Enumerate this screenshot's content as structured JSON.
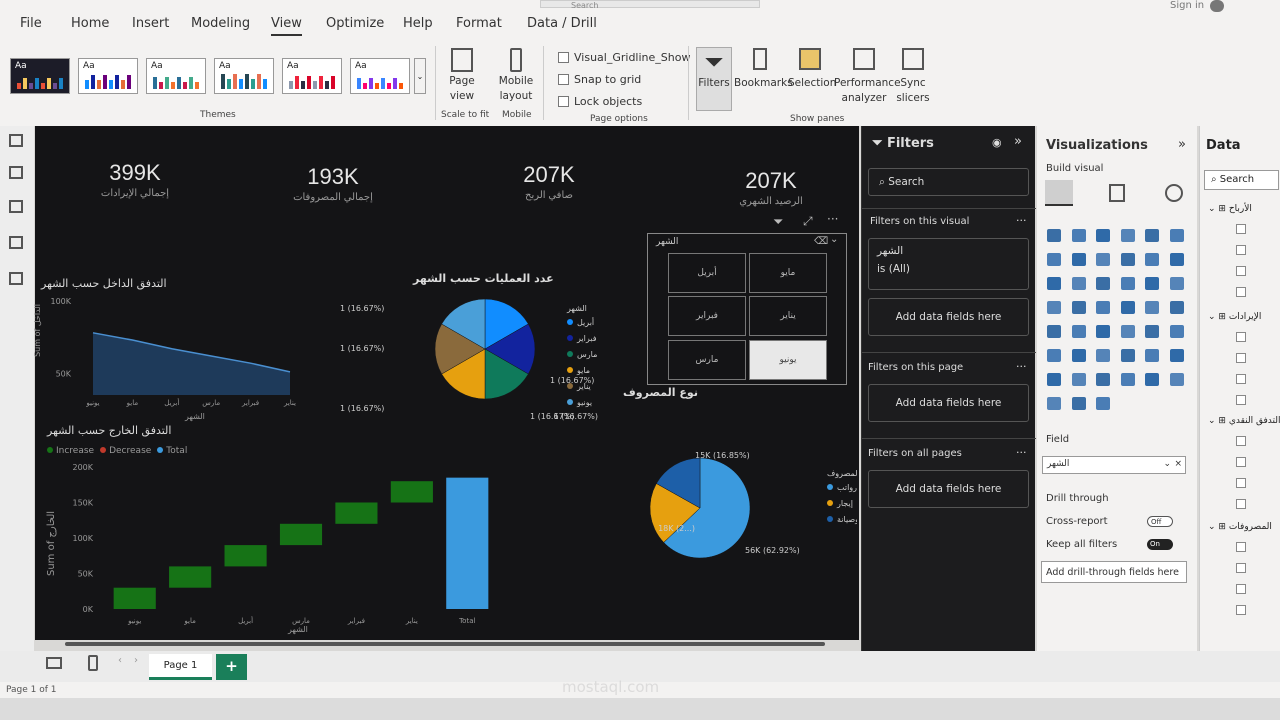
{
  "menu": {
    "items": [
      "File",
      "Home",
      "Insert",
      "Modeling",
      "View",
      "Optimize",
      "Help",
      "Format",
      "Data / Drill"
    ],
    "active": "View",
    "signin": "Sign in",
    "search": "Search"
  },
  "ribbon": {
    "themes_label": "Themes",
    "page_view": "Page view",
    "scale_to_fit": "Scale to fit",
    "mobile_layout": "Mobile layout",
    "mobile": "Mobile",
    "gridlines": "Visual_Gridline_Show",
    "snap": "Snap to grid",
    "lock": "Lock objects",
    "page_options": "Page options",
    "filters": "Filters",
    "bookmarks": "Bookmarks",
    "selection": "Selection",
    "performance": "Performance analyzer",
    "sync": "Sync slicers",
    "show_panes": "Show panes",
    "aa": "Aa"
  },
  "kpis": [
    {
      "value": "399K",
      "label": "إجمالي الإيرادات"
    },
    {
      "value": "193K",
      "label": "إجمالي المصروفات"
    },
    {
      "value": "207K",
      "label": "صافي الربح"
    },
    {
      "value": "207K",
      "label": "الرصيد الشهري"
    }
  ],
  "area_chart": {
    "title": "التدفق الداخل حسب الشهر",
    "ylabel": "Sum of الداخل",
    "xlabel": "الشهر"
  },
  "pie1": {
    "title": "عدد العمليات حسب الشهر",
    "legend_title": "الشهر"
  },
  "pie2": {
    "title": "نوع المصروف",
    "legend_title": "نوع المصروف"
  },
  "waterfall": {
    "title": "التدفق الخارج حسب الشهر",
    "ylabel": "Sum of الخارج",
    "xlabel": "الشهر",
    "legend": [
      "Increase",
      "Decrease",
      "Total"
    ]
  },
  "slicer": {
    "title": "الشهر",
    "items": [
      "أبريل",
      "مايو",
      "فبراير",
      "يناير",
      "مارس",
      "يونيو"
    ],
    "selected": "يونيو"
  },
  "chart_data": [
    {
      "type": "area",
      "title": "التدفق الداخل حسب الشهر",
      "categories": [
        "يونيو",
        "مايو",
        "أبريل",
        "مارس",
        "فبراير",
        "يناير"
      ],
      "values": [
        78,
        73,
        67,
        62,
        57,
        51
      ],
      "yticks": [
        "100K",
        "50K"
      ],
      "ylim": [
        35,
        100
      ]
    },
    {
      "type": "pie",
      "title": "عدد العمليات حسب الشهر",
      "categories": [
        "أبريل",
        "فبراير",
        "مارس",
        "مايو",
        "يناير",
        "يونيو"
      ],
      "values": [
        1,
        1,
        1,
        1,
        1,
        1
      ],
      "labels": [
        "1 (16.67%)",
        "1 (16.67%)",
        "1 (16.67%)",
        "1 (16.67%)",
        "1 (16.67%)",
        "1 (16.67%)"
      ],
      "colors": [
        "#118dff",
        "#12239e",
        "#0f7a5b",
        "#e6a00f",
        "#8a6a3c",
        "#4a9fd8"
      ]
    },
    {
      "type": "pie",
      "title": "نوع المصروف",
      "categories": [
        "رواتب",
        "إيجار",
        "تشغيل وصيانة"
      ],
      "values": [
        56,
        18,
        15
      ],
      "labels": [
        "56K (62.92%)",
        "18K (2...)",
        "15K (16.85%)"
      ],
      "colors": [
        "#3b9ade",
        "#e6a00f",
        "#1d5fa8"
      ]
    },
    {
      "type": "bar",
      "title": "التدفق الخارج حسب الشهر",
      "categories": [
        "يونيو",
        "مايو",
        "أبريل",
        "مارس",
        "فبراير",
        "يناير",
        "Total"
      ],
      "values": [
        30,
        30,
        30,
        30,
        30,
        30,
        185
      ],
      "yticks": [
        "200K",
        "150K",
        "100K",
        "50K",
        "0K"
      ],
      "ylim": [
        0,
        200
      ],
      "series": [
        {
          "name": "Increase"
        },
        {
          "name": "Decrease"
        },
        {
          "name": "Total"
        }
      ]
    }
  ],
  "filters": {
    "title": "Filters",
    "search": "Search",
    "on_visual": "Filters on this visual",
    "field": "الشهر",
    "field_state": "is (All)",
    "add": "Add data fields here",
    "on_page": "Filters on this page",
    "all_pages": "Filters on all pages"
  },
  "viz": {
    "title": "Visualizations",
    "build": "Build visual",
    "field": "Field",
    "field_value": "الشهر",
    "drill": "Drill through",
    "cross": "Cross-report",
    "keep": "Keep all filters",
    "off": "Off",
    "on": "On",
    "add_drill": "Add drill-through fields here"
  },
  "data": {
    "title": "Data",
    "search": "Search",
    "tables": [
      "الأرباح",
      "الإيرادات",
      "التدفق النقدي",
      "المصروفات"
    ]
  },
  "page": {
    "tab": "Page 1",
    "status": "Page 1 of 1"
  },
  "watermark": "mostaql.com"
}
